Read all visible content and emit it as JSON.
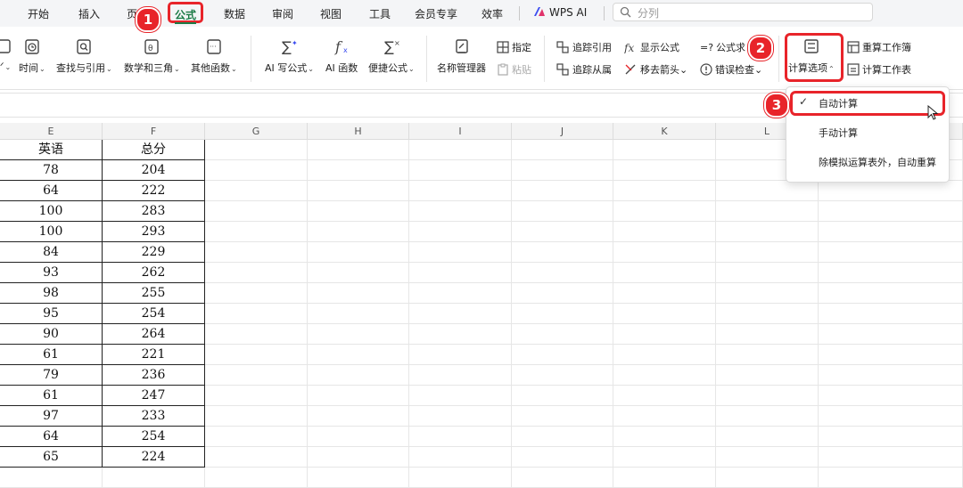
{
  "tabs": [
    "开始",
    "插入",
    "页",
    "公式",
    "数据",
    "审阅",
    "视图",
    "工具",
    "会员专享",
    "效率"
  ],
  "wps_ai": "WPS AI",
  "search_placeholder": "分列",
  "ribbon": {
    "time": "时间",
    "lookup": "查找与引用",
    "math": "数学和三角",
    "other": "其他函数",
    "ai_formula": "AI 写公式",
    "ai_func": "AI 函数",
    "quick_formula": "便捷公式",
    "name_manager": "名称管理器",
    "assign": "指定",
    "paste": "粘贴",
    "trace_precedents": "追踪引用",
    "trace_dependents": "追踪从属",
    "show_formulas": "显示公式",
    "remove_arrows": "移去箭头",
    "formula_eval": "公式求",
    "error_check": "错误检查",
    "calc_options": "计算选项",
    "recalc_workbook": "重算工作簿",
    "calc_sheet": "计算工作表"
  },
  "dropdown": [
    "自动计算",
    "手动计算",
    "除模拟运算表外，自动重算"
  ],
  "badges": [
    "1",
    "2",
    "3"
  ],
  "columns": [
    "E",
    "F",
    "G",
    "H",
    "I",
    "J",
    "K",
    "L"
  ],
  "table": {
    "headers": [
      "英语",
      "总分"
    ],
    "rows": [
      [
        "78",
        "204"
      ],
      [
        "64",
        "222"
      ],
      [
        "100",
        "283"
      ],
      [
        "100",
        "293"
      ],
      [
        "84",
        "229"
      ],
      [
        "93",
        "262"
      ],
      [
        "98",
        "255"
      ],
      [
        "95",
        "254"
      ],
      [
        "90",
        "264"
      ],
      [
        "61",
        "221"
      ],
      [
        "79",
        "236"
      ],
      [
        "61",
        "247"
      ],
      [
        "97",
        "233"
      ],
      [
        "64",
        "254"
      ],
      [
        "65",
        "224"
      ]
    ]
  },
  "colors": {
    "accent": "#e8242a",
    "active_tab": "#1a7a45"
  }
}
